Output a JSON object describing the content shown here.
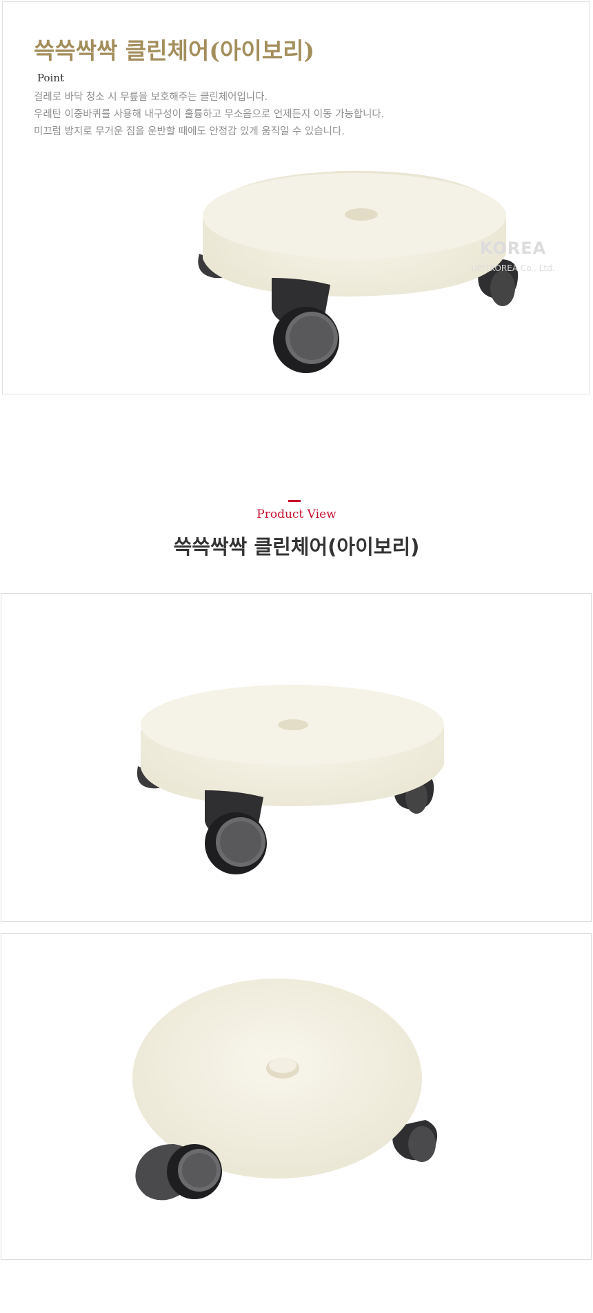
{
  "hero": {
    "title": "쓱쓱싹싹 클린체어(아이보리)",
    "point_label": "Point",
    "description": [
      "걸레로 바닥 청소 시 무릎을 보호해주는 클린체어입니다.",
      "우레탄 이중바퀴를 사용해 내구성이 훌륭하고 무소음으로 언제든지 이동 가능합니다.",
      "미끄럼 방지로 무거운 짐을 운반할 때에도 안정감 있게 움직일 수 있습니다."
    ],
    "watermark": {
      "logo": "KOREA",
      "company": "UPITKOREA Co., Ltd."
    }
  },
  "product_view": {
    "label": "Product View",
    "title": "쓱쓱싹싹 클린체어(아이보리)"
  },
  "colors": {
    "title_gold": "#a38e5c",
    "accent_red": "#c8102e",
    "seat_ivory": "#f1eedf",
    "caster_dark": "#2d2d2f"
  }
}
